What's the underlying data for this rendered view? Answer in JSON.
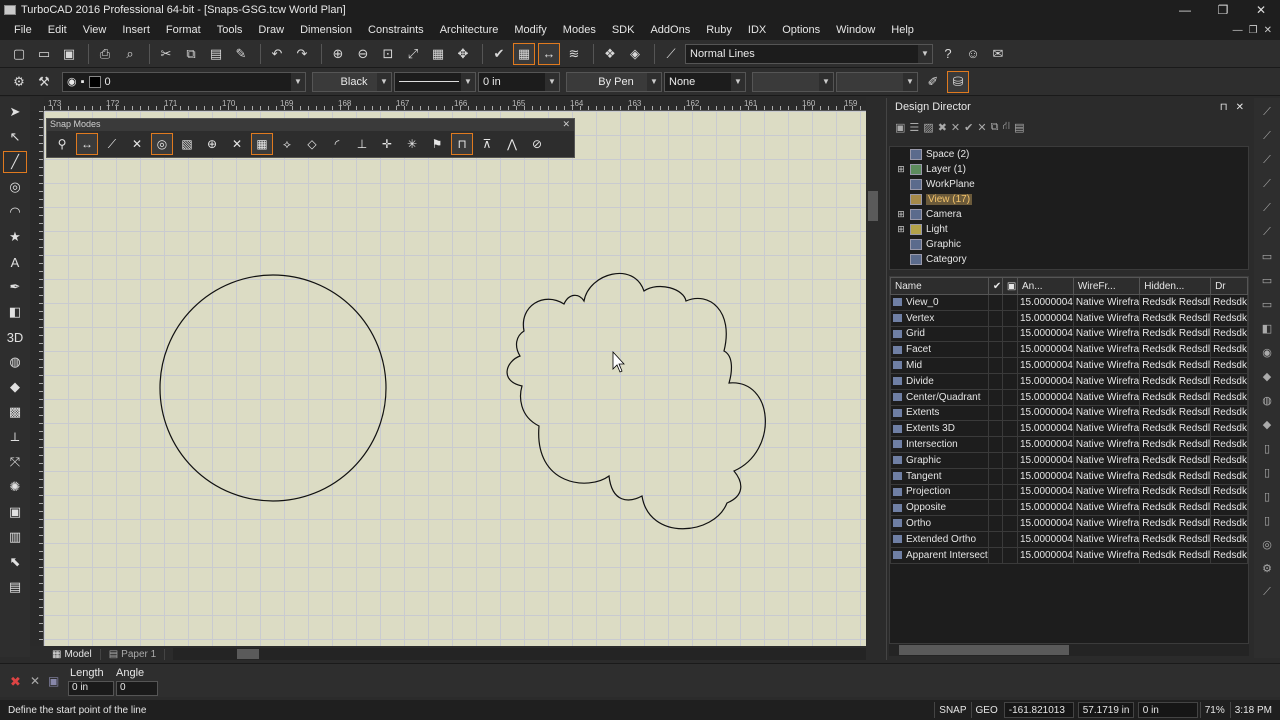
{
  "window": {
    "title": "TurboCAD 2016 Professional 64-bit - [Snaps-GSG.tcw World Plan]",
    "minimize": "—",
    "maximize": "❐",
    "close": "✕"
  },
  "menu": [
    "File",
    "Edit",
    "View",
    "Insert",
    "Format",
    "Tools",
    "Draw",
    "Dimension",
    "Constraints",
    "Architecture",
    "Modify",
    "Modes",
    "SDK",
    "AddOns",
    "Ruby",
    "IDX",
    "Options",
    "Window",
    "Help"
  ],
  "mdi_controls": [
    "—",
    "❐",
    "✕"
  ],
  "toolbar1": {
    "line_style": "Normal Lines"
  },
  "toolbar2": {
    "layer_value": "0",
    "color_value": "Black",
    "width_value": "0 in",
    "pen_value": "By Pen",
    "fill_value": "None"
  },
  "ruler": {
    "labels": [
      "173",
      "172",
      "171",
      "170",
      "169",
      "168",
      "167",
      "166",
      "165",
      "164",
      "163",
      "162",
      "161",
      "160",
      "159"
    ]
  },
  "snap_palette": {
    "title": "Snap Modes",
    "close": "✕"
  },
  "tabs": {
    "model": "Model",
    "paper": "Paper 1"
  },
  "design_director": {
    "title": "Design Director",
    "pin": "⊓",
    "close": "✕",
    "tree": [
      {
        "label": "Space (2)",
        "expandable": false
      },
      {
        "label": "Layer (1)",
        "expandable": true
      },
      {
        "label": "WorkPlane",
        "expandable": false
      },
      {
        "label": "View (17)",
        "expandable": false,
        "selected": true
      },
      {
        "label": "Camera",
        "expandable": true
      },
      {
        "label": "Light",
        "expandable": true
      },
      {
        "label": "Graphic",
        "expandable": false
      },
      {
        "label": "Category",
        "expandable": false
      }
    ],
    "columns": [
      "Name",
      "✔",
      "▣",
      "An...",
      "WireFr...",
      "Hidden...",
      "Dr"
    ],
    "rows": [
      {
        "name": "View_0",
        "an": "15.0000004",
        "wire": "Native Wirefra",
        "hidden": "Redsdk Redsdl",
        "dr": "Redsdk"
      },
      {
        "name": "Vertex",
        "an": "15.0000004",
        "wire": "Native Wirefra",
        "hidden": "Redsdk Redsdl",
        "dr": "Redsdk"
      },
      {
        "name": "Grid",
        "an": "15.0000004",
        "wire": "Native Wirefra",
        "hidden": "Redsdk Redsdl",
        "dr": "Redsdk"
      },
      {
        "name": "Facet",
        "an": "15.0000004",
        "wire": "Native Wirefra",
        "hidden": "Redsdk Redsdl",
        "dr": "Redsdk"
      },
      {
        "name": "Mid",
        "an": "15.0000004",
        "wire": "Native Wirefra",
        "hidden": "Redsdk Redsdl",
        "dr": "Redsdk"
      },
      {
        "name": "Divide",
        "an": "15.0000004",
        "wire": "Native Wirefra",
        "hidden": "Redsdk Redsdl",
        "dr": "Redsdk"
      },
      {
        "name": "Center/Quadrant",
        "an": "15.0000004",
        "wire": "Native Wirefra",
        "hidden": "Redsdk Redsdl",
        "dr": "Redsdk"
      },
      {
        "name": "Extents",
        "an": "15.0000004",
        "wire": "Native Wirefra",
        "hidden": "Redsdk Redsdl",
        "dr": "Redsdk"
      },
      {
        "name": "Extents 3D",
        "an": "15.0000004",
        "wire": "Native Wirefra",
        "hidden": "Redsdk Redsdl",
        "dr": "Redsdk"
      },
      {
        "name": "Intersection",
        "an": "15.0000004",
        "wire": "Native Wirefra",
        "hidden": "Redsdk Redsdl",
        "dr": "Redsdk"
      },
      {
        "name": "Graphic",
        "an": "15.0000004",
        "wire": "Native Wirefra",
        "hidden": "Redsdk Redsdl",
        "dr": "Redsdk"
      },
      {
        "name": "Tangent",
        "an": "15.0000004",
        "wire": "Native Wirefra",
        "hidden": "Redsdk Redsdl",
        "dr": "Redsdk"
      },
      {
        "name": "Projection",
        "an": "15.0000004",
        "wire": "Native Wirefra",
        "hidden": "Redsdk Redsdl",
        "dr": "Redsdk"
      },
      {
        "name": "Opposite",
        "an": "15.0000004",
        "wire": "Native Wirefra",
        "hidden": "Redsdk Redsdl",
        "dr": "Redsdk"
      },
      {
        "name": "Ortho",
        "an": "15.0000004",
        "wire": "Native Wirefra",
        "hidden": "Redsdk Redsdl",
        "dr": "Redsdk"
      },
      {
        "name": "Extended Ortho",
        "an": "15.0000004",
        "wire": "Native Wirefra",
        "hidden": "Redsdk Redsdl",
        "dr": "Redsdk"
      },
      {
        "name": "Apparent Intersect",
        "an": "15.0000004",
        "wire": "Native Wirefra",
        "hidden": "Redsdk Redsdl",
        "dr": "Redsdk"
      }
    ]
  },
  "inputbar": {
    "length_label": "Length",
    "angle_label": "Angle",
    "length_value": "0 in",
    "angle_value": "0"
  },
  "status": {
    "prompt": "Define the start point of the line",
    "snap": "SNAP",
    "geo": "GEO",
    "x": "-161.821013",
    "y": "57.1719 in",
    "z": "0 in",
    "zoom": "71%",
    "time": "3:18 PM"
  },
  "colors": {
    "accent": "#e07a1f",
    "canvas": "#dcdcc4",
    "grid": "#c9cbd0",
    "panel": "#2b2b2b"
  }
}
